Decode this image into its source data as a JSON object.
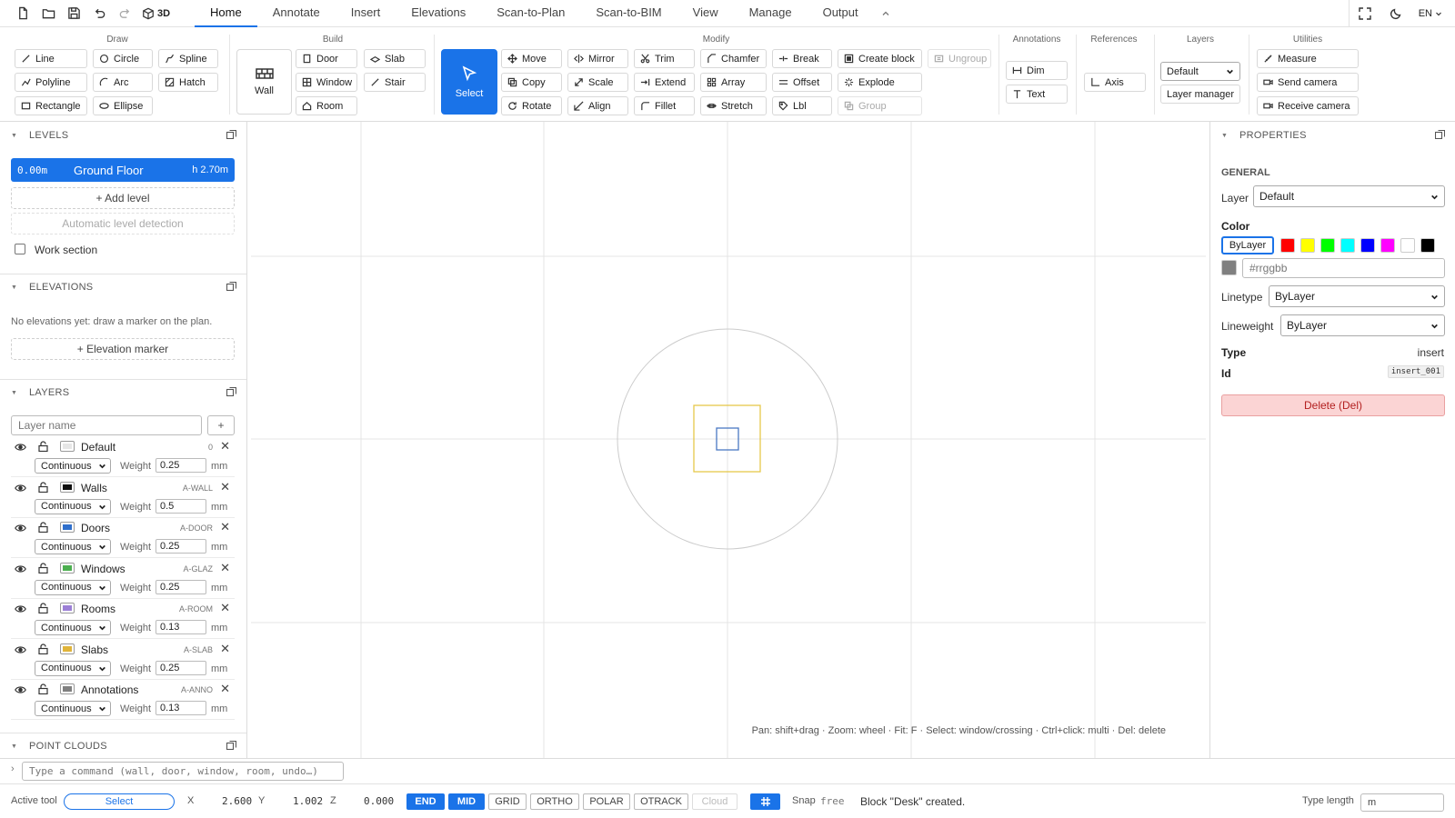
{
  "topbar": {
    "three_d": "3D",
    "tabs": [
      "Home",
      "Annotate",
      "Insert",
      "Elevations",
      "Scan-to-Plan",
      "Scan-to-BIM",
      "View",
      "Manage",
      "Output"
    ],
    "lang": "EN"
  },
  "ribbon": {
    "groups": {
      "draw": "Draw",
      "build": "Build",
      "modify": "Modify",
      "annotations": "Annotations",
      "references": "References",
      "layers": "Layers",
      "utilities": "Utilities"
    },
    "draw": [
      "Line",
      "Circle",
      "Spline",
      "Polyline",
      "Arc",
      "Hatch",
      "Rectangle",
      "Ellipse"
    ],
    "build": {
      "wall": "Wall",
      "door": "Door",
      "slab": "Slab",
      "window": "Window",
      "stair": "Stair",
      "room": "Room"
    },
    "select": "Select",
    "modify": {
      "move": "Move",
      "mirror": "Mirror",
      "trim": "Trim",
      "chamfer": "Chamfer",
      "break": "Break",
      "create_block": "Create block",
      "ungroup": "Ungroup",
      "copy": "Copy",
      "scale": "Scale",
      "extend": "Extend",
      "array": "Array",
      "offset": "Offset",
      "explode": "Explode",
      "rotate": "Rotate",
      "align": "Align",
      "fillet": "Fillet",
      "stretch": "Stretch",
      "lbl": "Lbl",
      "group": "Group"
    },
    "annotations": {
      "dim": "Dim",
      "text": "Text"
    },
    "references": {
      "axis": "Axis"
    },
    "layers": {
      "current": "Default",
      "manager": "Layer manager"
    },
    "utilities": {
      "measure": "Measure",
      "send": "Send camera",
      "receive": "Receive camera"
    }
  },
  "left": {
    "levels": {
      "title": "LEVELS",
      "elev": "0.00m",
      "name": "Ground Floor",
      "height": "h 2.70m",
      "add": "+ Add level",
      "auto": "Automatic level detection",
      "work": "Work section"
    },
    "elevations": {
      "title": "ELEVATIONS",
      "empty": "No elevations yet: draw a marker on the plan.",
      "add": "+ Elevation marker"
    },
    "layers": {
      "title": "LAYERS",
      "placeholder": "Layer name",
      "add": "+",
      "weight_label": "Weight",
      "unit": "mm",
      "items": [
        {
          "name": "Default",
          "code": "0",
          "linetype": "Continuous",
          "weight": "0.25",
          "color": "#e6e6e6"
        },
        {
          "name": "Walls",
          "code": "A-WALL",
          "linetype": "Continuous",
          "weight": "0.5",
          "color": "#111111"
        },
        {
          "name": "Doors",
          "code": "A-DOOR",
          "linetype": "Continuous",
          "weight": "0.25",
          "color": "#2f6fcc"
        },
        {
          "name": "Windows",
          "code": "A-GLAZ",
          "linetype": "Continuous",
          "weight": "0.25",
          "color": "#4caf50"
        },
        {
          "name": "Rooms",
          "code": "A-ROOM",
          "linetype": "Continuous",
          "weight": "0.13",
          "color": "#9c7fd6"
        },
        {
          "name": "Slabs",
          "code": "A-SLAB",
          "linetype": "Continuous",
          "weight": "0.25",
          "color": "#e0b43a"
        },
        {
          "name": "Annotations",
          "code": "A-ANNO",
          "linetype": "Continuous",
          "weight": "0.13",
          "color": "#808080"
        }
      ]
    },
    "pointclouds": {
      "title": "POINT CLOUDS"
    }
  },
  "canvas": {
    "hint": "Pan: shift+drag · Zoom: wheel · Fit: F · Select: window/crossing · Ctrl+click: multi · Del: delete"
  },
  "properties": {
    "title": "PROPERTIES",
    "general": "GENERAL",
    "layer_label": "Layer",
    "layer": "Default",
    "color_label": "Color",
    "bylayer": "ByLayer",
    "swatches": [
      "#ff0000",
      "#ffff00",
      "#00ff00",
      "#00ffff",
      "#0000ff",
      "#ff00ff",
      "#ffffff",
      "#000000"
    ],
    "custom_swatch": "#808080",
    "hex_placeholder": "#rrggbb",
    "linetype_label": "Linetype",
    "linetype": "ByLayer",
    "lineweight_label": "Lineweight",
    "lineweight": "ByLayer",
    "type_label": "Type",
    "type": "insert",
    "id_label": "Id",
    "id": "insert_001",
    "delete": "Delete (Del)"
  },
  "command": {
    "placeholder": "Type a command (wall, door, window, room, undo…)"
  },
  "status": {
    "active_tool_label": "Active tool",
    "active_tool": "Select",
    "x_label": "X",
    "x": "2.600",
    "y_label": "Y",
    "y": "1.002",
    "z_label": "Z",
    "z": "0.000",
    "snaps": [
      {
        "label": "END",
        "on": true
      },
      {
        "label": "MID",
        "on": true
      },
      {
        "label": "GRID",
        "on": false
      },
      {
        "label": "ORTHO",
        "on": false
      },
      {
        "label": "POLAR",
        "on": false
      },
      {
        "label": "OTRACK",
        "on": false
      },
      {
        "label": "Cloud",
        "on": false
      }
    ],
    "snap_label": "Snap",
    "snap_value": "free",
    "message": "Block \"Desk\" created.",
    "type_length_label": "Type length",
    "type_length_value": "m"
  },
  "colors": {
    "accent": "#1a73e8",
    "block_outer": "#e6c84a",
    "block_inner": "#4a78c2",
    "grid": "#e4e4e4",
    "circle": "#cccccc"
  }
}
